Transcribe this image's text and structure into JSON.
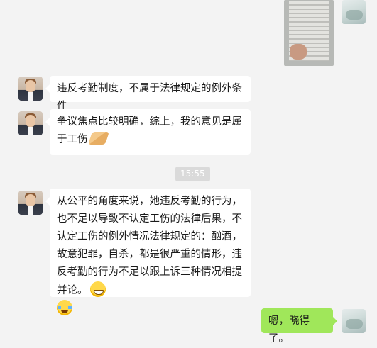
{
  "chat": {
    "messages": [
      {
        "id": "m1",
        "sender": "lawyer",
        "text": "违反考勤制度，不属于法律规定的例外条件"
      },
      {
        "id": "m2",
        "sender": "lawyer",
        "text": "争议焦点比较明确，综上，我的意见是属于工伤",
        "emoji": "clap-icon"
      },
      {
        "id": "m3",
        "sender": "lawyer",
        "text": "从公平的角度来说，她违反考勤的行为，也不足以导致不认定工伤的法律后果，不认定工伤的例外情况法律规定的：酗酒，故意犯罪，自杀，都是很严重的情形，违反考勤的行为不足以跟上诉三种情况相提并论。",
        "emojis": [
          "grin-icon",
          "tears-of-joy-icon"
        ]
      },
      {
        "id": "m4",
        "sender": "user",
        "text": "嗯，晓得了。"
      }
    ],
    "timestamp": "15:55"
  },
  "colors": {
    "background": "#f3f3f3",
    "bubble_incoming": "#ffffff",
    "bubble_outgoing": "#a0e75a"
  }
}
